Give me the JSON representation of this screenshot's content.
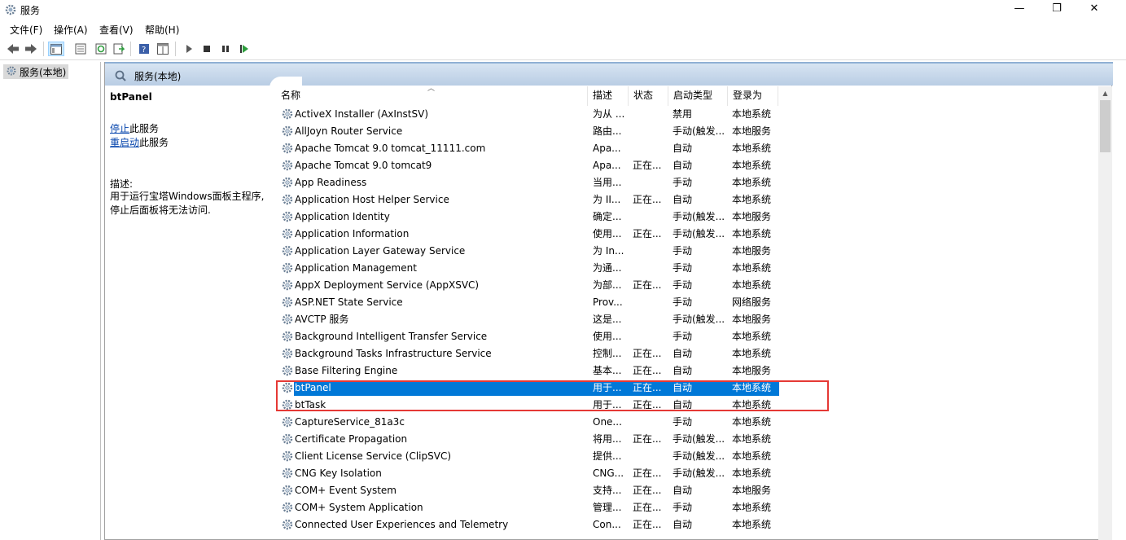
{
  "window": {
    "title": "服务",
    "min_glyph": "—",
    "max_glyph": "❐",
    "close_glyph": "✕"
  },
  "menu": [
    "文件(F)",
    "操作(A)",
    "查看(V)",
    "帮助(H)"
  ],
  "toolbar_icons": [
    "back-arrow-icon",
    "forward-arrow-icon",
    "console-tree-icon",
    "properties-icon",
    "refresh-icon",
    "export-list-icon",
    "help-icon",
    "detail-view-icon",
    "start-service-icon",
    "stop-service-icon",
    "pause-service-icon",
    "restart-service-icon"
  ],
  "tree": {
    "root_label": "服务(本地)"
  },
  "panel": {
    "header_title": "服务(本地)"
  },
  "details": {
    "service_name": "btPanel",
    "stop_link": "停止",
    "stop_suffix": "此服务",
    "restart_link": "重启动",
    "restart_suffix": "此服务",
    "desc_label": "描述:",
    "desc_text": "用于运行宝塔Windows面板主程序,停止后面板将无法访问."
  },
  "columns": {
    "name": "名称",
    "desc": "描述",
    "status": "状态",
    "startup": "启动类型",
    "logon": "登录为"
  },
  "rows": [
    {
      "name": "ActiveX Installer (AxInstSV)",
      "desc": "为从 ...",
      "status": "",
      "startup": "禁用",
      "logon": "本地系统"
    },
    {
      "name": "AllJoyn Router Service",
      "desc": "路由...",
      "status": "",
      "startup": "手动(触发...",
      "logon": "本地服务"
    },
    {
      "name": "Apache Tomcat 9.0 tomcat_11111.com",
      "desc": "Apa...",
      "status": "",
      "startup": "自动",
      "logon": "本地系统"
    },
    {
      "name": "Apache Tomcat 9.0 tomcat9",
      "desc": "Apa...",
      "status": "正在...",
      "startup": "自动",
      "logon": "本地系统"
    },
    {
      "name": "App Readiness",
      "desc": "当用...",
      "status": "",
      "startup": "手动",
      "logon": "本地系统"
    },
    {
      "name": "Application Host Helper Service",
      "desc": "为 II...",
      "status": "正在...",
      "startup": "自动",
      "logon": "本地系统"
    },
    {
      "name": "Application Identity",
      "desc": "确定...",
      "status": "",
      "startup": "手动(触发...",
      "logon": "本地服务"
    },
    {
      "name": "Application Information",
      "desc": "使用...",
      "status": "正在...",
      "startup": "手动(触发...",
      "logon": "本地系统"
    },
    {
      "name": "Application Layer Gateway Service",
      "desc": "为 In...",
      "status": "",
      "startup": "手动",
      "logon": "本地服务"
    },
    {
      "name": "Application Management",
      "desc": "为通...",
      "status": "",
      "startup": "手动",
      "logon": "本地系统"
    },
    {
      "name": "AppX Deployment Service (AppXSVC)",
      "desc": "为部...",
      "status": "正在...",
      "startup": "手动",
      "logon": "本地系统"
    },
    {
      "name": "ASP.NET State Service",
      "desc": "Prov...",
      "status": "",
      "startup": "手动",
      "logon": "网络服务"
    },
    {
      "name": "AVCTP 服务",
      "desc": "这是...",
      "status": "",
      "startup": "手动(触发...",
      "logon": "本地服务"
    },
    {
      "name": "Background Intelligent Transfer Service",
      "desc": "使用...",
      "status": "",
      "startup": "手动",
      "logon": "本地系统"
    },
    {
      "name": "Background Tasks Infrastructure Service",
      "desc": "控制...",
      "status": "正在...",
      "startup": "自动",
      "logon": "本地系统"
    },
    {
      "name": "Base Filtering Engine",
      "desc": "基本...",
      "status": "正在...",
      "startup": "自动",
      "logon": "本地服务"
    },
    {
      "name": "btPanel",
      "desc": "用于...",
      "status": "正在...",
      "startup": "自动",
      "logon": "本地系统",
      "selected": true
    },
    {
      "name": "btTask",
      "desc": "用于...",
      "status": "正在...",
      "startup": "自动",
      "logon": "本地系统"
    },
    {
      "name": "CaptureService_81a3c",
      "desc": "One...",
      "status": "",
      "startup": "手动",
      "logon": "本地系统"
    },
    {
      "name": "Certificate Propagation",
      "desc": "将用...",
      "status": "正在...",
      "startup": "手动(触发...",
      "logon": "本地系统"
    },
    {
      "name": "Client License Service (ClipSVC)",
      "desc": "提供...",
      "status": "",
      "startup": "手动(触发...",
      "logon": "本地系统"
    },
    {
      "name": "CNG Key Isolation",
      "desc": "CNG...",
      "status": "正在...",
      "startup": "手动(触发...",
      "logon": "本地系统"
    },
    {
      "name": "COM+ Event System",
      "desc": "支持...",
      "status": "正在...",
      "startup": "自动",
      "logon": "本地服务"
    },
    {
      "name": "COM+ System Application",
      "desc": "管理...",
      "status": "正在...",
      "startup": "手动",
      "logon": "本地系统"
    },
    {
      "name": "Connected User Experiences and Telemetry",
      "desc": "Con...",
      "status": "正在...",
      "startup": "自动",
      "logon": "本地系统"
    }
  ],
  "colors": {
    "selection": "#0078d7",
    "highlight_box": "#e53935",
    "link": "#0645ad"
  }
}
